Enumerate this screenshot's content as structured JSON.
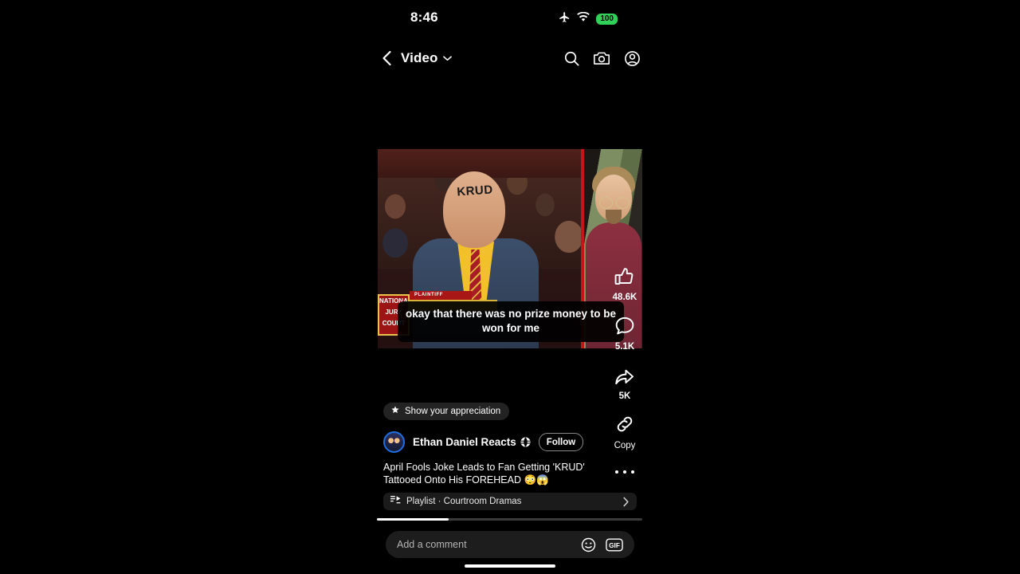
{
  "status_bar": {
    "time": "8:46",
    "airplane_icon": "airplane-icon",
    "wifi_icon": "wifi-icon",
    "battery_level": "100",
    "battery_color": "#30d158"
  },
  "header": {
    "back_icon": "chevron-left-icon",
    "title": "Video",
    "caret_icon": "chevron-down-icon",
    "search_icon": "search-icon",
    "camera_icon": "camera-icon",
    "account_icon": "account-circle-icon"
  },
  "video": {
    "caption": "okay that there was no prize money to be won for me",
    "forehead_tattoo_text": "KRUD",
    "lower_third_role": "PLAINTIFF",
    "show_logo_text": "NATIONAL JURY COURT",
    "divider_color": "#c81414"
  },
  "actions": {
    "like": {
      "icon": "thumbs-up-icon",
      "count": "48.6K"
    },
    "comment": {
      "icon": "comment-bubble-icon",
      "count": "5.1K"
    },
    "share": {
      "icon": "share-arrow-icon",
      "count": "5K"
    },
    "copy": {
      "icon": "link-icon",
      "label": "Copy"
    }
  },
  "appreciation_chip": {
    "icon": "sparkle-star-icon",
    "label": "Show your appreciation"
  },
  "channel": {
    "avatar": "channel-avatar",
    "name": "Ethan Daniel Reacts",
    "badge_icon": "globe-icon",
    "follow_label": "Follow"
  },
  "post": {
    "title": "April Fools Joke Leads to Fan Getting 'KRUD' Tattooed Onto His FOREHEAD 😳😱",
    "more_icon": "more-horizontal-icon"
  },
  "playlist": {
    "icon": "playlist-icon",
    "label": "Playlist · Courtroom Dramas",
    "chevron_icon": "chevron-right-icon"
  },
  "progress": {
    "percent": "27"
  },
  "comment_input": {
    "placeholder": "Add a comment",
    "emoji_icon": "emoji-smiley-icon",
    "gif_icon": "gif-icon",
    "gif_label": "GIF"
  }
}
